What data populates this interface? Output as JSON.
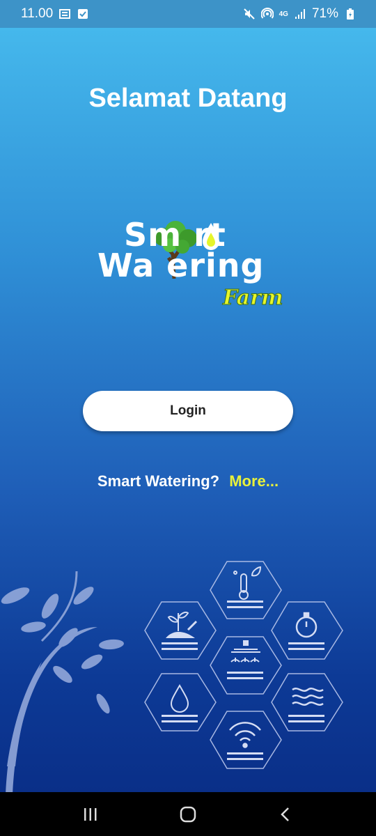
{
  "status_bar": {
    "time": "11.00",
    "battery": "71%",
    "network": "4G",
    "icons_left": [
      "news-icon",
      "checkbox-icon"
    ],
    "icons_right": [
      "mute-icon",
      "hotspot-icon",
      "network-4g-icon",
      "signal-icon",
      "battery-icon"
    ]
  },
  "welcome": {
    "title": "Selamat Datang"
  },
  "logo": {
    "line1": "Sm  rt",
    "line2": "Wa ering",
    "tag": "Farm"
  },
  "actions": {
    "login_label": "Login"
  },
  "info": {
    "question": "Smart Watering?",
    "more_label": "More..."
  },
  "nav_bar": {
    "icons": [
      "recents-icon",
      "home-icon",
      "back-icon"
    ]
  },
  "colors": {
    "gradient_top": "#45b8ec",
    "gradient_bottom": "#0a2f88",
    "accent_yellow": "#e8f13a",
    "button_bg": "#ffffff"
  }
}
